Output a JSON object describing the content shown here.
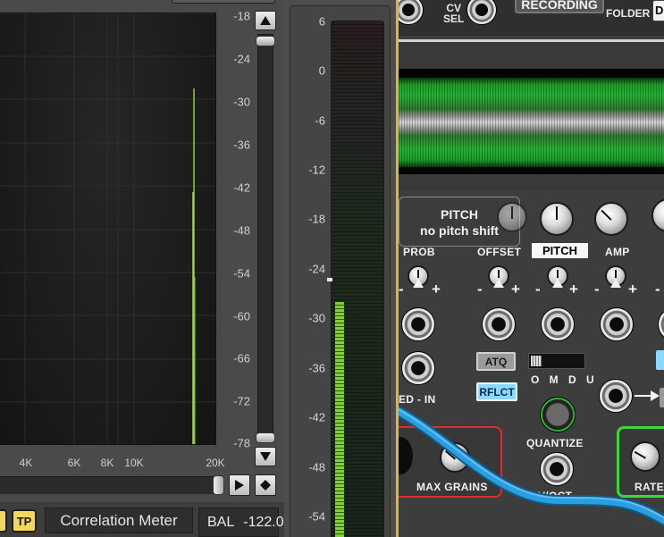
{
  "spectrum": {
    "db_labels": [
      "-18",
      "-24",
      "-30",
      "-36",
      "-42",
      "-48",
      "-54",
      "-60",
      "-66",
      "-72",
      "-78"
    ],
    "freq_labels": [
      "4K",
      "6K",
      "8K",
      "10K",
      "20K"
    ]
  },
  "bottom": {
    "tp_label": "TP",
    "meter_title": "Correlation Meter",
    "bal_label": "BAL",
    "bal_value": "-122.0"
  },
  "level_meter": {
    "scale_labels": [
      "6",
      "0",
      "-6",
      "-12",
      "-18",
      "-24",
      "-30",
      "-36",
      "-42",
      "-48",
      "-54"
    ],
    "level_db": -25.5
  },
  "rack": {
    "top": {
      "cv_sel_label_1": "CV",
      "cv_sel_label_2": "SEL",
      "recording_label": "RECORDING",
      "folder_label": "FOLDER",
      "folder_box": "D"
    },
    "tooltip": {
      "line1": "PITCH",
      "line2": "no pitch shift"
    },
    "labels": {
      "prob": "PROB",
      "offset": "OFFSET",
      "pitch": "PITCH",
      "amp": "AMP",
      "ed_in": "ED - IN",
      "atq": "ATQ",
      "rflct": "RFLCT",
      "omdu": "O M D U",
      "quantize": "QUANTIZE",
      "max_grains": "MAX GRAINS",
      "voct": "V/OCT",
      "rate": "RATE"
    },
    "colors": {
      "rack_border": "#e0b63a",
      "red_frame": "#e52b2b",
      "green_frame": "#3bd83b",
      "cable": "#1f8fd0"
    }
  }
}
